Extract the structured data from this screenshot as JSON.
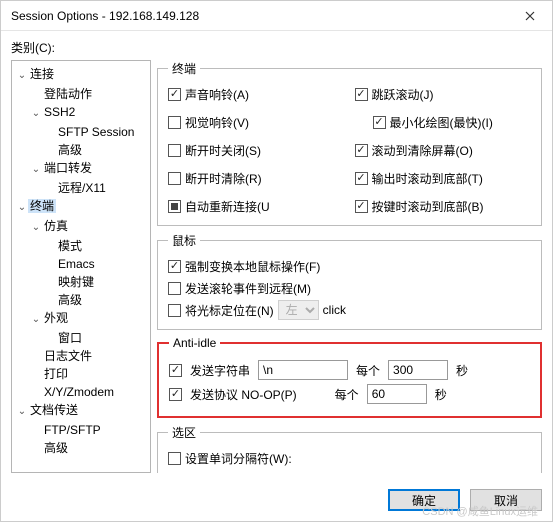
{
  "window": {
    "title": "Session Options - 192.168.149.128"
  },
  "category_label": "类别(C):",
  "tree": {
    "nodes": [
      {
        "label": "连接",
        "depth": 0,
        "expandable": true
      },
      {
        "label": "登陆动作",
        "depth": 1
      },
      {
        "label": "SSH2",
        "depth": 1,
        "expandable": true
      },
      {
        "label": "SFTP Session",
        "depth": 2
      },
      {
        "label": "高级",
        "depth": 2
      },
      {
        "label": "端口转发",
        "depth": 1,
        "expandable": true
      },
      {
        "label": "远程/X11",
        "depth": 2
      },
      {
        "label": "终端",
        "depth": 0,
        "expandable": true,
        "selected": true
      },
      {
        "label": "仿真",
        "depth": 1,
        "expandable": true
      },
      {
        "label": "模式",
        "depth": 2
      },
      {
        "label": "Emacs",
        "depth": 2
      },
      {
        "label": "映射键",
        "depth": 2
      },
      {
        "label": "高级",
        "depth": 2
      },
      {
        "label": "外观",
        "depth": 1,
        "expandable": true
      },
      {
        "label": "窗口",
        "depth": 2
      },
      {
        "label": "日志文件",
        "depth": 1
      },
      {
        "label": "打印",
        "depth": 1
      },
      {
        "label": "X/Y/Zmodem",
        "depth": 1
      },
      {
        "label": "文档传送",
        "depth": 0,
        "expandable": true
      },
      {
        "label": "FTP/SFTP",
        "depth": 1
      },
      {
        "label": "高级",
        "depth": 1
      }
    ]
  },
  "terminal": {
    "legend": "终端",
    "left": [
      {
        "key": "audiobell",
        "label": "声音响铃(A)",
        "checked": true
      },
      {
        "key": "visualbell",
        "label": "视觉响铃(V)",
        "checked": false
      },
      {
        "key": "close_on_disc",
        "label": "断开时关闭(S)",
        "checked": false
      },
      {
        "key": "clear_on_disc",
        "label": "断开时清除(R)",
        "checked": false
      },
      {
        "key": "auto_reconnect",
        "label": "自动重新连接(U",
        "checked": true,
        "square": true
      }
    ],
    "right": [
      {
        "key": "jump_scroll",
        "label": "跳跃滚动(J)",
        "checked": true
      },
      {
        "key": "min_draw",
        "label": "最小化绘图(最快)(I)",
        "checked": true,
        "indent": true
      },
      {
        "key": "scroll_clear",
        "label": "滚动到清除屏幕(O)",
        "checked": true
      },
      {
        "key": "scroll_bottom_out",
        "label": "输出时滚动到底部(T)",
        "checked": true
      },
      {
        "key": "scroll_bottom_key",
        "label": "按键时滚动到底部(B)",
        "checked": true
      }
    ]
  },
  "mouse": {
    "legend": "鼠标",
    "items": [
      {
        "key": "force_local",
        "label": "强制变换本地鼠标操作(F)",
        "checked": true
      },
      {
        "key": "wheel_remote",
        "label": "发送滚轮事件到远程(M)",
        "checked": false
      }
    ],
    "cursor_fix": {
      "label": "将光标定位在(N)",
      "checked": false,
      "select_value": "左",
      "trail": "click"
    }
  },
  "anti_idle": {
    "legend": "Anti-idle",
    "send_string": {
      "label": "发送字符串",
      "checked": true,
      "value": "\\n",
      "every_label": "每个",
      "interval": "300",
      "unit": "秒"
    },
    "send_proto": {
      "label": "发送协议 NO-OP(P)",
      "checked": true,
      "every_label": "每个",
      "interval": "60",
      "unit": "秒"
    }
  },
  "selection": {
    "legend": "选区",
    "word_delim": {
      "label": "设置单词分隔符(W):",
      "checked": false
    }
  },
  "buttons": {
    "ok": "确定",
    "cancel": "取消"
  },
  "watermark": "CSDN @咸鱼Linux运维"
}
